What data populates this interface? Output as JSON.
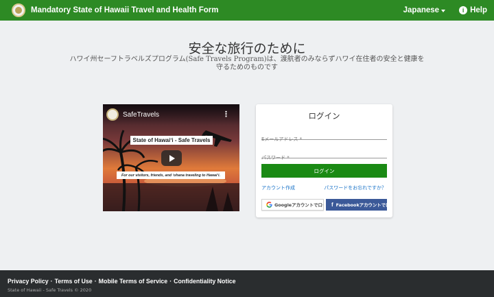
{
  "header": {
    "title": "Mandatory State of Hawaii Travel and Health Form",
    "language": "Japanese",
    "help": "Help",
    "brand_color": "#2d8a24"
  },
  "hero": {
    "title": "安全な旅行のために",
    "subtitle": "ハワイ州セーフトラベルズプログラム(Safe Travels Program)は、渡航者のみならずハワイ在住者の安全と健康を守るためのものです"
  },
  "video": {
    "channel": "SafeTravels",
    "banner": "State of Hawaiʻi - Safe Travels",
    "caption": "For our visitors, friends, and ʻohana traveling to Hawaiʻi."
  },
  "login": {
    "title": "ログイン",
    "email_placeholder": "Eメールアドレス *",
    "password_placeholder": "パスワード *",
    "login_button": "ログイン",
    "create_account": "アカウント作成",
    "forgot_password": "パスワードをお忘れですか？",
    "google_button": "Googleアカウントでログイン",
    "facebook_button": "Facebookアカウントでログイン",
    "button_color": "#1a8a14",
    "facebook_color": "#3b5998"
  },
  "footer": {
    "links": [
      "Privacy Policy",
      "Terms of Use",
      "Mobile Terms of Service",
      "Confidentiality Notice"
    ],
    "copyright": "State of Hawaii - Safe Travels © 2020"
  }
}
